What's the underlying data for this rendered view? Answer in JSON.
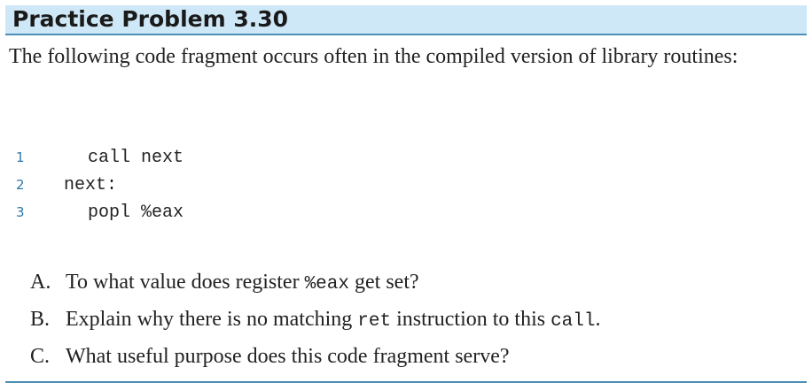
{
  "title": "Practice Problem 3.30",
  "intro": "The following code fragment occurs often in the compiled version of library routines:",
  "code": [
    {
      "num": "1",
      "text": "call next"
    },
    {
      "num": "2",
      "text": "next:"
    },
    {
      "num": "3",
      "text": "popl %eax"
    }
  ],
  "questions": {
    "a": {
      "letter": "A.",
      "pre": "To what value does register ",
      "code": "%eax",
      "post": " get set?"
    },
    "b": {
      "letter": "B.",
      "pre": "Explain why there is no matching ",
      "code": "ret",
      "mid": " instruction to this ",
      "code2": "call",
      "post": "."
    },
    "c": {
      "letter": "C.",
      "text": "What useful purpose does this code fragment serve?"
    }
  },
  "colors": {
    "header_bg": "#cfe8f7",
    "rule": "#4d90b5",
    "line_number": "#2f78a6"
  }
}
